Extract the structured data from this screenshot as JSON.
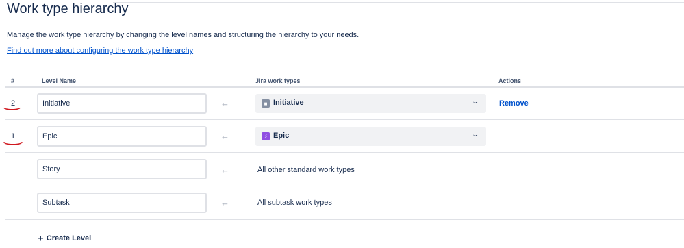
{
  "page": {
    "title": "Work type hierarchy",
    "description": "Manage the work type hierarchy by changing the level names and structuring the hierarchy to your needs.",
    "learn_more": "Find out more about configuring the work type hierarchy"
  },
  "table": {
    "headers": {
      "num": "#",
      "level_name": "Level Name",
      "work_types": "Jira work types",
      "actions": "Actions"
    },
    "rows": [
      {
        "num": "2",
        "level_name": "Initiative",
        "work_type": "Initiative",
        "work_type_icon": "initiative-icon",
        "action": "Remove"
      },
      {
        "num": "1",
        "level_name": "Epic",
        "work_type": "Epic",
        "work_type_icon": "epic-icon"
      },
      {
        "num": "",
        "level_name": "Story",
        "work_types_text": "All other standard work types"
      },
      {
        "num": "",
        "level_name": "Subtask",
        "work_types_text": "All subtask work types"
      }
    ]
  },
  "create_level": {
    "label": "Create Level",
    "icon": "plus-icon"
  },
  "colors": {
    "link": "#0052CC",
    "epic": "#904EE2",
    "initiative": "#8590A2",
    "annotation": "#D0181F"
  }
}
